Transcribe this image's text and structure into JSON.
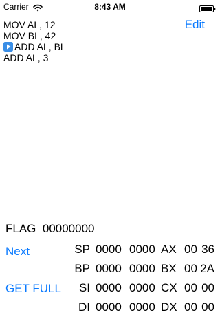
{
  "status_bar": {
    "carrier": "Carrier",
    "wifi_icon": "wifi-icon",
    "time": "8:43 AM",
    "battery_icon": "battery-full-icon"
  },
  "program": {
    "lines": [
      {
        "text": "MOV AL, 12",
        "current": false
      },
      {
        "text": "MOV BL, 42",
        "current": false
      },
      {
        "text": "ADD AL, BL",
        "current": true
      },
      {
        "text": "ADD AL, 3",
        "current": false
      }
    ],
    "current_marker_icon": "play-icon",
    "edit_label": "Edit"
  },
  "flags": {
    "label": "FLAG",
    "value": "00000000"
  },
  "controls": {
    "next_label": "Next",
    "get_full_label": "GET FULL"
  },
  "registers": [
    {
      "name": "SP",
      "hi16": "0000",
      "lo16": "0000",
      "gname": "AX",
      "hi8": "00",
      "lo8": "36"
    },
    {
      "name": "BP",
      "hi16": "0000",
      "lo16": "0000",
      "gname": "BX",
      "hi8": "00",
      "lo8": "2A"
    },
    {
      "name": "SI",
      "hi16": "0000",
      "lo16": "0000",
      "gname": "CX",
      "hi8": "00",
      "lo8": "00"
    },
    {
      "name": "DI",
      "hi16": "0000",
      "lo16": "0000",
      "gname": "DX",
      "hi8": "00",
      "lo8": "00"
    }
  ],
  "colors": {
    "accent": "#0a7aff",
    "play_icon": "#3a8ee6"
  }
}
